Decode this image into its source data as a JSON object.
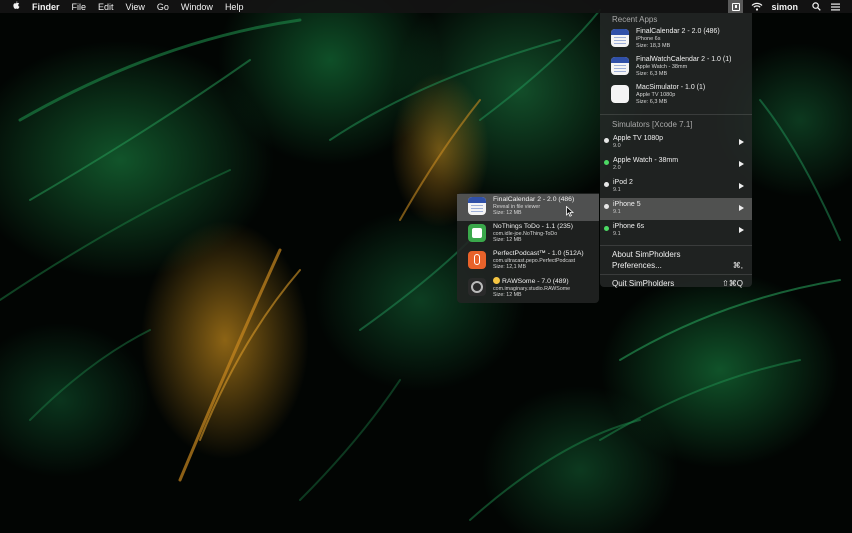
{
  "menubar": {
    "app_name": "Finder",
    "items": [
      "File",
      "Edit",
      "View",
      "Go",
      "Window",
      "Help"
    ],
    "user_name": "simon"
  },
  "simpholders": {
    "recent_header": "Recent Apps",
    "recent_apps": [
      {
        "title": "FinalCalendar 2 - 2.0 (486)",
        "line1": "iPhone 6s",
        "line2": "Size: 18,3 MB",
        "icon": "calendar-icon"
      },
      {
        "title": "FinalWatchCalendar 2 - 1.0 (1)",
        "line1": "Apple Watch - 38mm",
        "line2": "Size: 6,3 MB",
        "icon": "calendar-icon"
      },
      {
        "title": "MacSimulator - 1.0 (1)",
        "line1": "Apple TV 1080p",
        "line2": "Size: 6,3 MB",
        "icon": "blank-app-icon"
      }
    ],
    "simulators_header": "Simulators [Xcode 7.1]",
    "simulators": [
      {
        "name": "Apple TV 1080p",
        "version": "9.0",
        "status": "booted",
        "dot_color": "#e6e6e6"
      },
      {
        "name": "Apple Watch - 38mm",
        "version": "2.0",
        "status": "running",
        "dot_color": "#4cd964"
      },
      {
        "name": "iPod 2",
        "version": "9.1",
        "status": "booted",
        "dot_color": "#e6e6e6"
      },
      {
        "name": "iPhone 5",
        "version": "9.1",
        "status": "booted",
        "dot_color": "#e6e6e6",
        "highlighted": true
      },
      {
        "name": "iPhone 6s",
        "version": "9.1",
        "status": "running",
        "dot_color": "#4cd964"
      }
    ],
    "about_label": "About SimPholders",
    "preferences_label": "Preferences...",
    "preferences_shortcut": "⌘,",
    "quit_label": "Quit SimPholders",
    "quit_shortcut": "⇧⌘Q"
  },
  "submenu": {
    "items": [
      {
        "title": "FinalCalendar 2 - 2.0 (486)",
        "line1": "Reveal in file viewer",
        "line2": "Size: 12 MB",
        "icon": "calendar-icon",
        "highlighted": true
      },
      {
        "title": "NoThings ToDo - 1.1 (235)",
        "line1": "com.idle-joe.NoThing-ToDo",
        "line2": "Size: 12 MB",
        "icon": "nothings-icon"
      },
      {
        "title": "PerfectPodcast™ - 1.0 (512A)",
        "line1": "com.ultracast.pepo.PerfectPodcast",
        "line2": "Size: 12,1 MB",
        "icon": "podcast-icon"
      },
      {
        "title": "RAWSome - 7.0 (489)",
        "line1": "com.imaginary.studio.RAWSome",
        "line2": "Size: 12 MB",
        "icon": "raw-icon"
      }
    ]
  },
  "colors": {
    "accent_green": "#4cd964",
    "menu_bg": "#262a28",
    "highlight": "#787878"
  }
}
